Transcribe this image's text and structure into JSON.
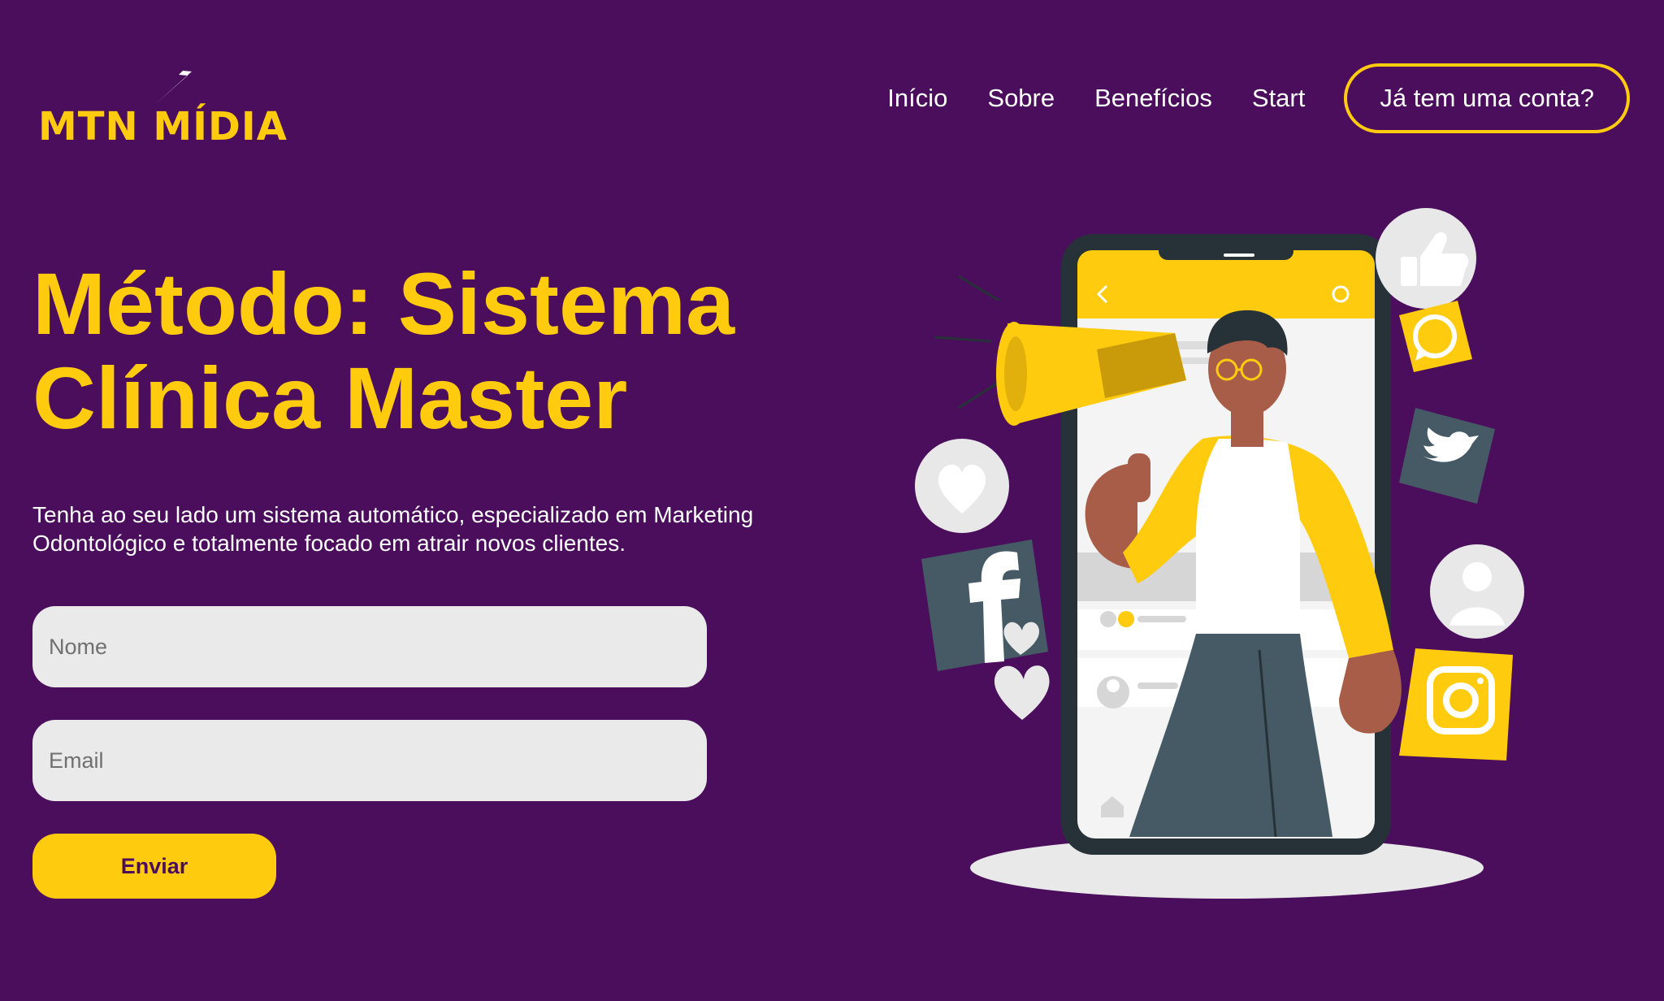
{
  "logo": {
    "text": "MTN MÍDIA",
    "icon": "lightning-bolt-icon"
  },
  "nav": {
    "items": [
      {
        "label": "Início"
      },
      {
        "label": "Sobre"
      },
      {
        "label": "Benefícios"
      },
      {
        "label": "Start"
      }
    ],
    "account_button": "Já tem uma conta?"
  },
  "hero": {
    "title": "Método: Sistema Clínica Master",
    "description": "Tenha ao seu lado um sistema automático, especializado em Marketing Odontológico e totalmente focado em atrair novos clientes."
  },
  "form": {
    "name_placeholder": "Nome",
    "email_placeholder": "Email",
    "submit_label": "Enviar"
  },
  "illustration": {
    "subject": "man-with-megaphone-in-phone",
    "icons": [
      "like-icon",
      "whatsapp-icon",
      "twitter-icon",
      "heart-icon",
      "facebook-icon",
      "user-icon",
      "instagram-icon"
    ]
  },
  "colors": {
    "background": "#4b0e5c",
    "accent": "#ffcb0f",
    "text": "#ffffff",
    "input_bg": "#eaeaea",
    "icon_slate": "#455a64"
  }
}
